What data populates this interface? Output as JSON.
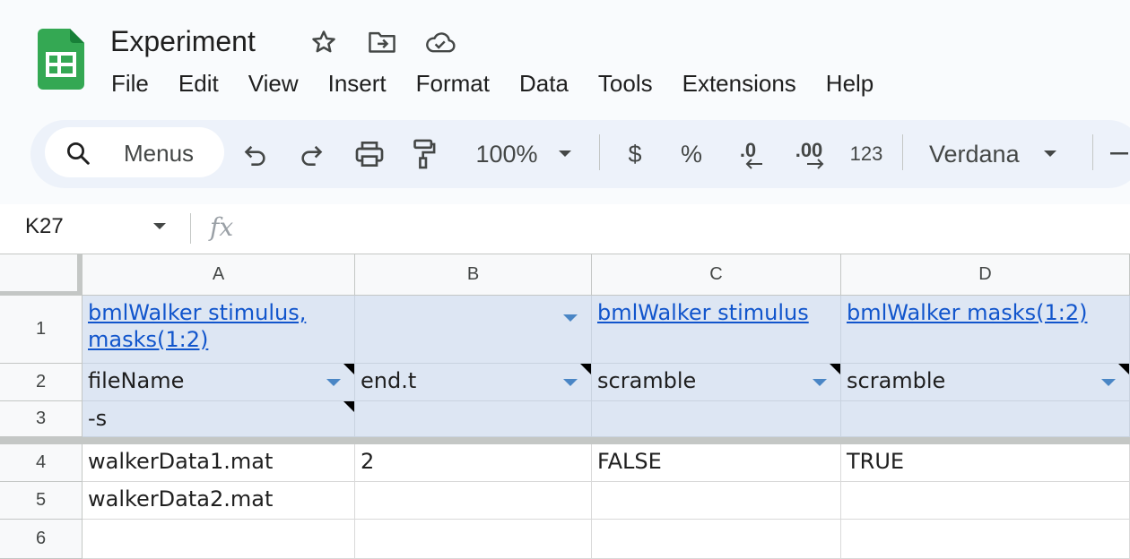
{
  "app": {
    "title": "Experiment",
    "colors": {
      "sheets_green": "#34a853",
      "link": "#1155cc",
      "header_band": "#dde6f3"
    }
  },
  "title_icons": [
    "star-icon",
    "move-to-folder-icon",
    "cloud-saved-icon"
  ],
  "menu": {
    "file": "File",
    "edit": "Edit",
    "view": "View",
    "insert": "Insert",
    "format": "Format",
    "data": "Data",
    "tools": "Tools",
    "extensions": "Extensions",
    "help": "Help"
  },
  "toolbar": {
    "search_placeholder": "Menus",
    "zoom": "100%",
    "currency": "$",
    "percent": "%",
    "decrease_decimal": ".0",
    "increase_decimal": ".00",
    "number_format": "123",
    "font": "Verdana"
  },
  "formula_bar": {
    "name_box": "K27",
    "fx_label": "fx"
  },
  "grid": {
    "columns": [
      "A",
      "B",
      "C",
      "D"
    ],
    "rows": [
      "1",
      "2",
      "3",
      "4",
      "5",
      "6"
    ],
    "row1": {
      "a": "bmlWalker stimulus, masks(1:2)",
      "c": "bmlWalker stimulus",
      "d": "bmlWalker masks(1:2)"
    },
    "row2": {
      "a": "fileName",
      "b": "end.t",
      "c": "scramble",
      "d": "scramble"
    },
    "row3": {
      "a": "-s"
    },
    "row4": {
      "a": "walkerData1.mat",
      "b": "2",
      "c": "FALSE",
      "d": "TRUE"
    },
    "row5": {
      "a": "walkerData2.mat"
    }
  }
}
